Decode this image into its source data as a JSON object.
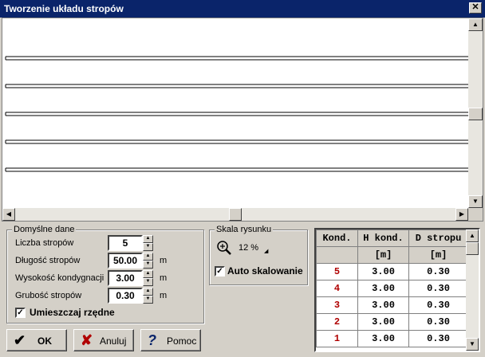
{
  "window": {
    "title": "Tworzenie układu stropów",
    "close_glyph": "✕"
  },
  "defaults": {
    "group_label": "Domyślne dane",
    "fields": [
      {
        "label": "Liczba stropów",
        "value": "5",
        "unit": ""
      },
      {
        "label": "Długość stropów",
        "value": "50.00",
        "unit": "m"
      },
      {
        "label": "Wysokość kondygnacji",
        "value": "3.00",
        "unit": "m"
      },
      {
        "label": "Grubość stropów",
        "value": "0.30",
        "unit": "m"
      }
    ],
    "checkbox_label": "Umieszczaj rzędne",
    "checkbox_checked": true
  },
  "scale": {
    "group_label": "Skala rysunku",
    "value": "12 %",
    "auto_label": "Auto skalowanie",
    "auto_checked": true
  },
  "buttons": {
    "ok": "OK",
    "cancel": "Anuluj",
    "help": "Pomoc"
  },
  "table": {
    "headers": [
      "Kond.",
      "H kond.",
      "D stropu"
    ],
    "units": [
      "",
      "[m]",
      "[m]"
    ],
    "rows": [
      {
        "kond": "5",
        "h": "3.00",
        "d": "0.30"
      },
      {
        "kond": "4",
        "h": "3.00",
        "d": "0.30"
      },
      {
        "kond": "3",
        "h": "3.00",
        "d": "0.30"
      },
      {
        "kond": "2",
        "h": "3.00",
        "d": "0.30"
      },
      {
        "kond": "1",
        "h": "3.00",
        "d": "0.30"
      }
    ]
  },
  "colors": {
    "titlebar": "#0a246a",
    "face": "#d4d0c8",
    "row_number": "#b00000"
  }
}
